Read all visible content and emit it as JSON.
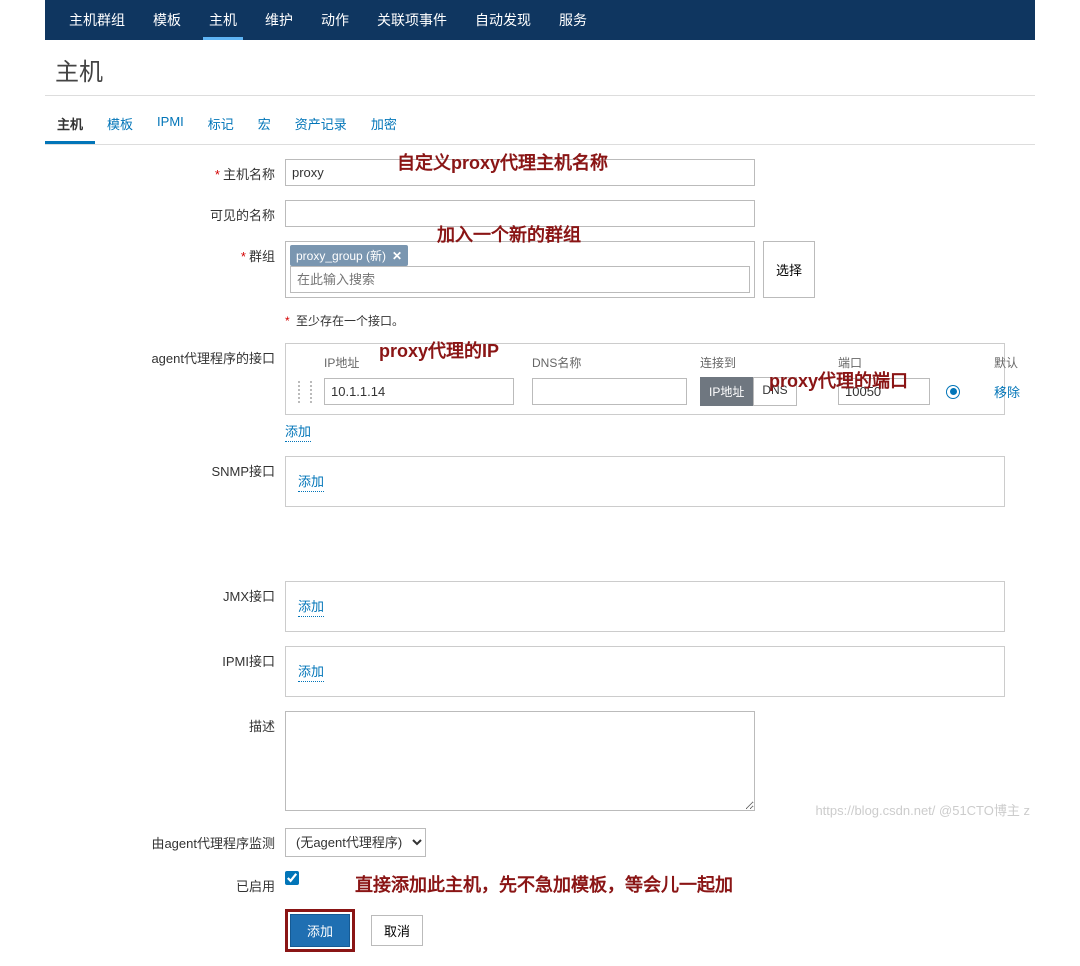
{
  "nav": {
    "items": [
      "主机群组",
      "模板",
      "主机",
      "维护",
      "动作",
      "关联项事件",
      "自动发现",
      "服务"
    ],
    "active": "主机"
  },
  "title": "主机",
  "tabs": {
    "items": [
      "主机",
      "模板",
      "IPMI",
      "标记",
      "宏",
      "资产记录",
      "加密"
    ],
    "active": "主机"
  },
  "form": {
    "hostname": {
      "label": "主机名称",
      "value": "proxy"
    },
    "visible": {
      "label": "可见的名称",
      "value": ""
    },
    "group": {
      "label": "群组",
      "tag": "proxy_group (新)",
      "placeholder": "在此输入搜索",
      "select_btn": "选择"
    },
    "iface_hint": "至少存在一个接口。",
    "agent": {
      "label": "agent代理程序的接口",
      "head": {
        "ip": "IP地址",
        "dns": "DNS名称",
        "conn": "连接到",
        "port": "端口",
        "def": "默认"
      },
      "row": {
        "ip": "10.1.1.14",
        "dns": "",
        "conn_ip": "IP地址",
        "conn_dns": "DNS",
        "port": "10050",
        "remove": "移除"
      },
      "add": "添加"
    },
    "snmp": {
      "label": "SNMP接口",
      "add": "添加"
    },
    "jmx": {
      "label": "JMX接口",
      "add": "添加"
    },
    "ipmi": {
      "label": "IPMI接口",
      "add": "添加"
    },
    "desc": {
      "label": "描述",
      "value": ""
    },
    "monitored": {
      "label": "由agent代理程序监测",
      "value": "(无agent代理程序)"
    },
    "enabled": {
      "label": "已启用"
    },
    "submit": "添加",
    "cancel": "取消"
  },
  "annot": {
    "a1": "自定义proxy代理主机名称",
    "a2": "加入一个新的群组",
    "a3": "proxy代理的IP",
    "a4": "proxy代理的端口",
    "a5": "直接添加此主机，先不急加模板，等会儿一起加"
  },
  "watermark": "https://blog.csdn.net/ @51CTO博主 z"
}
